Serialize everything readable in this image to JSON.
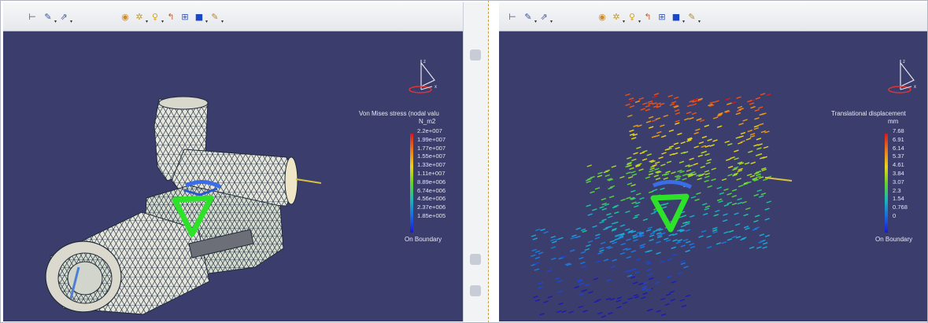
{
  "left_panel": {
    "legend": {
      "title": "Von Mises stress (nodal valu",
      "unit": "N_m2",
      "values": [
        "2.2e+007",
        "1.99e+007",
        "1.77e+007",
        "1.55e+007",
        "1.33e+007",
        "1.11e+007",
        "8.89e+006",
        "6.74e+006",
        "4.56e+006",
        "2.37e+006",
        "1.85e+005"
      ],
      "footer": "On Boundary"
    }
  },
  "right_panel": {
    "legend": {
      "title": "Translational displacement",
      "unit": "mm",
      "values": [
        "7.68",
        "6.91",
        "6.14",
        "5.37",
        "4.61",
        "3.84",
        "3.07",
        "2.3",
        "1.54",
        "0.768",
        "0"
      ],
      "footer": "On Boundary"
    }
  },
  "toolbar": {
    "group1_icons": [
      "axis-icon",
      "pin-icon",
      "arrows-icon"
    ],
    "group2_icons": [
      "render-style-icon",
      "sparkle-icon",
      "light-bulb-icon",
      "wrench-icon",
      "grid-icon",
      "material-icon",
      "magic-icon"
    ]
  },
  "colors": {
    "viewport_bg": "#3b3e6d",
    "mesh_fill": "#e8e6dc",
    "clamp_green": "#2ee22a",
    "legend_top": "#d61a1a",
    "legend_bottom": "#1a1ad6"
  }
}
